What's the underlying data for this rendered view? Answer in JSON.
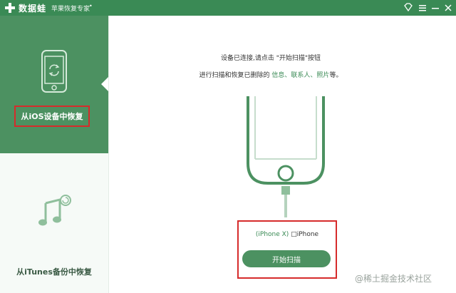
{
  "titlebar": {
    "app_name": "数据蛙",
    "subtitle": "苹果恢复专家",
    "dot": "•",
    "icons": [
      "diamond-icon",
      "menu-icon",
      "minimize-icon",
      "close-icon"
    ]
  },
  "sidebar": {
    "items": [
      {
        "label": "从iOS设备中恢复",
        "icon": "phone-restore-icon",
        "selected": true
      },
      {
        "label": "从iTunes备份中恢复",
        "icon": "music-restore-icon",
        "selected": false
      }
    ]
  },
  "main": {
    "message_line1": "设备已连接,请点击 \"开始扫描\"按钮",
    "message_line2_prefix": "进行扫描和恢复已删除的 ",
    "message_line2_items": "信息、联系人、照片",
    "message_line2_suffix": "等。",
    "device_model": "(iPhone X)",
    "device_name": "□iPhone",
    "start_button": "开始扫描"
  },
  "watermark": "@稀土掘金技术社区",
  "colors": {
    "brand": "#3a8a55",
    "sidebar_active": "#4c9161",
    "highlight": "#d62b2b"
  }
}
